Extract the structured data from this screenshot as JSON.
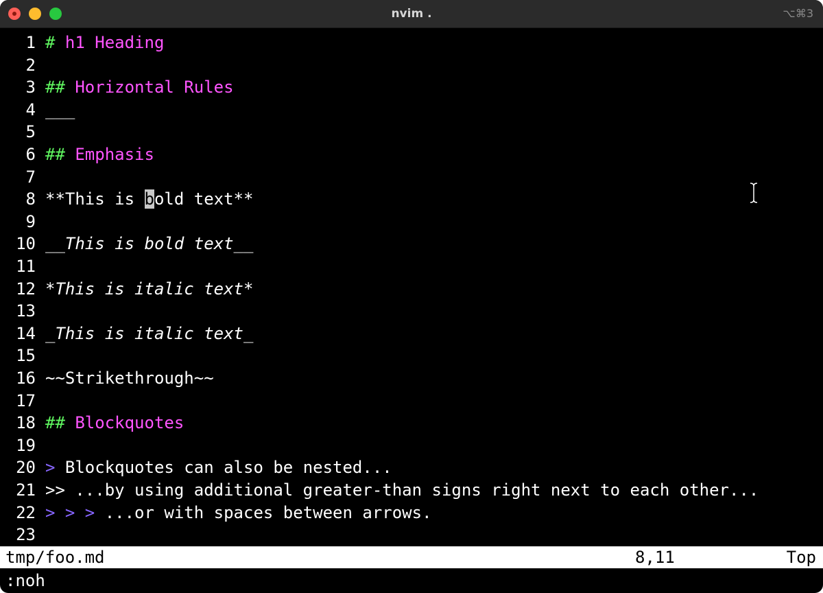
{
  "window": {
    "title": "nvim .",
    "shortcut": "⌥⌘3"
  },
  "editor": {
    "lines": [
      {
        "num": "1",
        "parts": [
          {
            "text": "# ",
            "style": "marker"
          },
          {
            "text": "h1 Heading",
            "style": "heading"
          }
        ]
      },
      {
        "num": "2",
        "parts": []
      },
      {
        "num": "3",
        "parts": [
          {
            "text": "## ",
            "style": "marker"
          },
          {
            "text": "Horizontal Rules",
            "style": "heading"
          }
        ]
      },
      {
        "num": "4",
        "parts": [
          {
            "text": "___",
            "style": "plain"
          }
        ]
      },
      {
        "num": "5",
        "parts": []
      },
      {
        "num": "6",
        "parts": [
          {
            "text": "## ",
            "style": "marker"
          },
          {
            "text": "Emphasis",
            "style": "heading"
          }
        ]
      },
      {
        "num": "7",
        "parts": []
      },
      {
        "num": "8",
        "parts": [
          {
            "text": "**This is ",
            "style": "plain"
          },
          {
            "text": "b",
            "style": "cursor"
          },
          {
            "text": "old text**",
            "style": "plain"
          }
        ]
      },
      {
        "num": "9",
        "parts": []
      },
      {
        "num": "10",
        "parts": [
          {
            "text": "__This is bold text__",
            "style": "italic"
          }
        ]
      },
      {
        "num": "11",
        "parts": []
      },
      {
        "num": "12",
        "parts": [
          {
            "text": "*This is italic text*",
            "style": "italic"
          }
        ]
      },
      {
        "num": "13",
        "parts": []
      },
      {
        "num": "14",
        "parts": [
          {
            "text": "_This is italic text_",
            "style": "italic"
          }
        ]
      },
      {
        "num": "15",
        "parts": []
      },
      {
        "num": "16",
        "parts": [
          {
            "text": "~~Strikethrough~~",
            "style": "plain"
          }
        ]
      },
      {
        "num": "17",
        "parts": []
      },
      {
        "num": "18",
        "parts": [
          {
            "text": "## ",
            "style": "marker"
          },
          {
            "text": "Blockquotes",
            "style": "heading"
          }
        ]
      },
      {
        "num": "19",
        "parts": []
      },
      {
        "num": "20",
        "parts": [
          {
            "text": "> ",
            "style": "quote"
          },
          {
            "text": "Blockquotes can also be nested...",
            "style": "plain"
          }
        ]
      },
      {
        "num": "21",
        "parts": [
          {
            "text": ">> ...by using additional greater-than signs right next to each other...",
            "style": "plain"
          }
        ]
      },
      {
        "num": "22",
        "parts": [
          {
            "text": "> > > ",
            "style": "quote"
          },
          {
            "text": "...or with spaces between arrows.",
            "style": "plain"
          }
        ]
      },
      {
        "num": "23",
        "parts": []
      }
    ]
  },
  "statusline": {
    "file": "tmp/foo.md",
    "position": "8,11",
    "scroll": "Top"
  },
  "cmdline": {
    "text": ":noh"
  },
  "colors": {
    "background": "#000000",
    "marker": "#5ff55f",
    "heading": "#ff55ff",
    "quote": "#8866ff",
    "text": "#ffffff"
  }
}
